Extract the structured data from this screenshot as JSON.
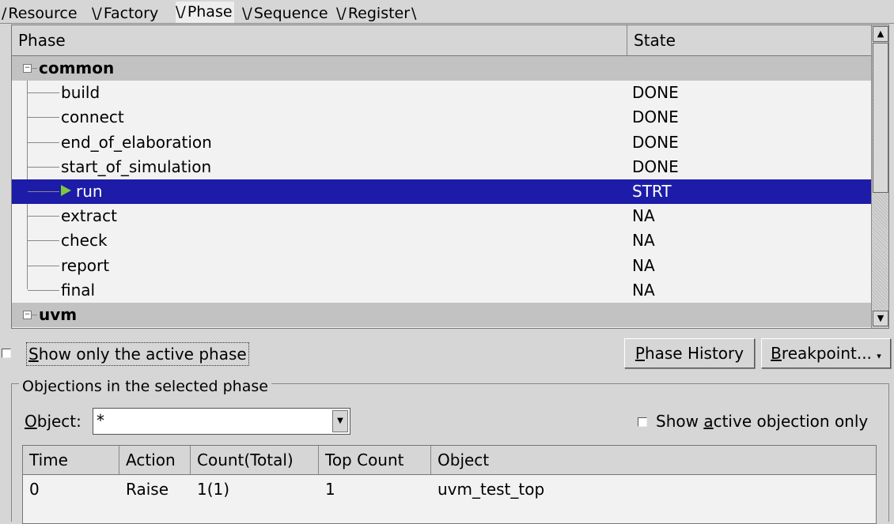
{
  "tabs": [
    "Resource",
    "Factory",
    "Phase",
    "Sequence",
    "Register"
  ],
  "tree": {
    "columns": [
      "Phase",
      "State"
    ],
    "groups": [
      {
        "name": "common",
        "items": [
          {
            "name": "build",
            "state": "DONE"
          },
          {
            "name": "connect",
            "state": "DONE"
          },
          {
            "name": "end_of_elaboration",
            "state": "DONE"
          },
          {
            "name": "start_of_simulation",
            "state": "DONE"
          },
          {
            "name": "run",
            "state": "STRT"
          },
          {
            "name": "extract",
            "state": "NA"
          },
          {
            "name": "check",
            "state": "NA"
          },
          {
            "name": "report",
            "state": "NA"
          },
          {
            "name": "final",
            "state": "NA"
          }
        ]
      },
      {
        "name": "uvm",
        "items": []
      }
    ]
  },
  "controls": {
    "show_active_phase": "Show only the active phase",
    "phase_history": "Phase History",
    "breakpoint": "Breakpoint..."
  },
  "objections": {
    "title": "Objections in the selected phase",
    "object_label": "Object:",
    "object_value": "*",
    "show_active_only": "Show active objection only",
    "columns": [
      "Time",
      "Action",
      "Count(Total)",
      "Top Count",
      "Object"
    ],
    "rows": [
      {
        "time": "0",
        "action": "Raise",
        "count": "1(1)",
        "top": "1",
        "object": "uvm_test_top"
      }
    ]
  }
}
